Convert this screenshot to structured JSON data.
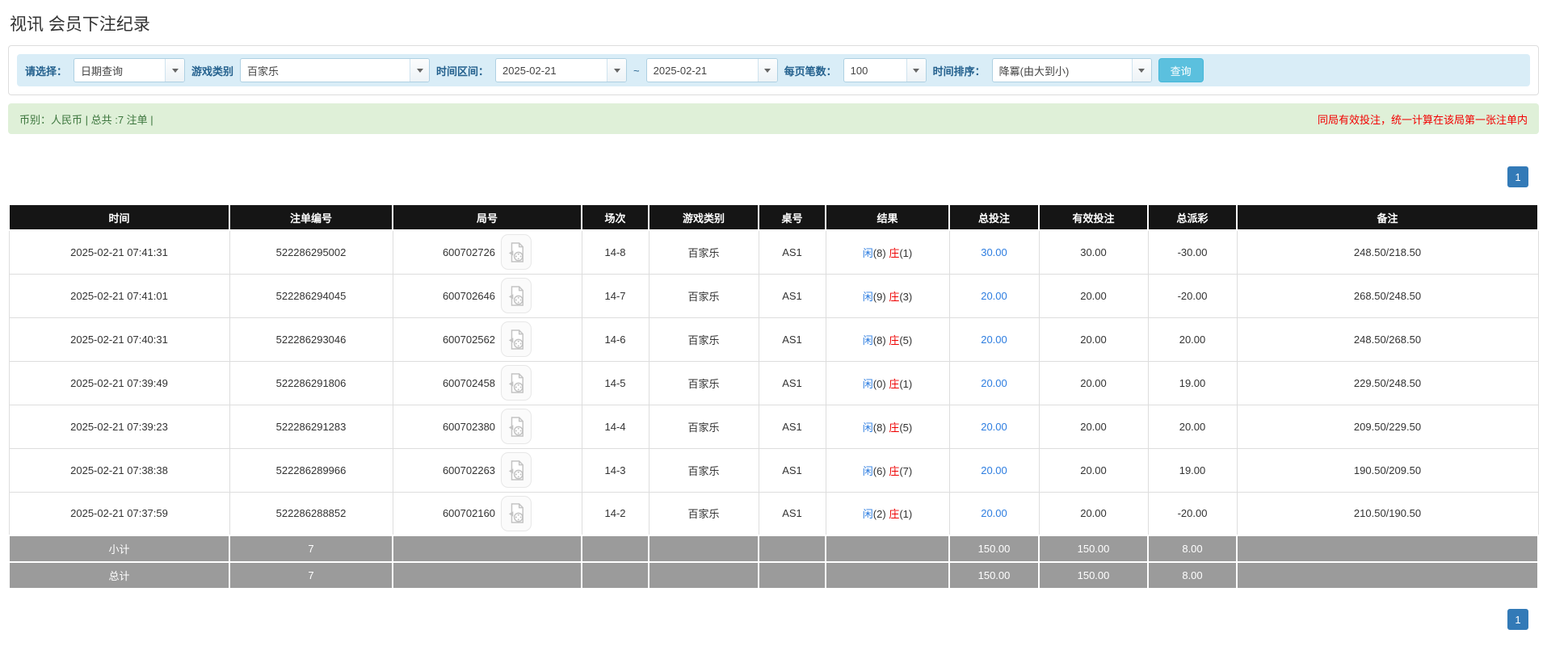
{
  "page": {
    "title": "视讯 会员下注纪录"
  },
  "filters": {
    "select_label": "请选择：",
    "select_value": "日期查询",
    "game_label": "游戏类别",
    "game_value": "百家乐",
    "time_label": "时间区间：",
    "date_from": "2025-02-21",
    "tilde": "~",
    "date_to": "2025-02-21",
    "per_page_label": "每页笔数：",
    "per_page_value": "100",
    "sort_label": "时间排序：",
    "sort_value": "降冪(由大到小)",
    "search_button": "查询"
  },
  "summary_bar": {
    "left": "币别：人民币 | 总共 :7 注单 |",
    "right": "同局有效投注，统一计算在该局第一张注单内"
  },
  "pagination": {
    "page": "1"
  },
  "table": {
    "headers": [
      "时间",
      "注单编号",
      "局号",
      "场次",
      "游戏类别",
      "桌号",
      "结果",
      "总投注",
      "有效投注",
      "总派彩",
      "备注"
    ],
    "rows": [
      {
        "time": "2025-02-21 07:41:31",
        "bet_no": "522286295002",
        "round_no": "600702726",
        "session": "14-8",
        "game": "百家乐",
        "table_no": "AS1",
        "result_player": "闲",
        "result_player_num": "(8)",
        "result_banker": "庄",
        "result_banker_num": "(1)",
        "total_bet": "30.00",
        "valid_bet": "30.00",
        "payout": "-30.00",
        "note": "248.50/218.50"
      },
      {
        "time": "2025-02-21 07:41:01",
        "bet_no": "522286294045",
        "round_no": "600702646",
        "session": "14-7",
        "game": "百家乐",
        "table_no": "AS1",
        "result_player": "闲",
        "result_player_num": "(9)",
        "result_banker": "庄",
        "result_banker_num": "(3)",
        "total_bet": "20.00",
        "valid_bet": "20.00",
        "payout": "-20.00",
        "note": "268.50/248.50"
      },
      {
        "time": "2025-02-21 07:40:31",
        "bet_no": "522286293046",
        "round_no": "600702562",
        "session": "14-6",
        "game": "百家乐",
        "table_no": "AS1",
        "result_player": "闲",
        "result_player_num": "(8)",
        "result_banker": "庄",
        "result_banker_num": "(5)",
        "total_bet": "20.00",
        "valid_bet": "20.00",
        "payout": "20.00",
        "note": "248.50/268.50"
      },
      {
        "time": "2025-02-21 07:39:49",
        "bet_no": "522286291806",
        "round_no": "600702458",
        "session": "14-5",
        "game": "百家乐",
        "table_no": "AS1",
        "result_player": "闲",
        "result_player_num": "(0)",
        "result_banker": "庄",
        "result_banker_num": "(1)",
        "total_bet": "20.00",
        "valid_bet": "20.00",
        "payout": "19.00",
        "note": "229.50/248.50"
      },
      {
        "time": "2025-02-21 07:39:23",
        "bet_no": "522286291283",
        "round_no": "600702380",
        "session": "14-4",
        "game": "百家乐",
        "table_no": "AS1",
        "result_player": "闲",
        "result_player_num": "(8)",
        "result_banker": "庄",
        "result_banker_num": "(5)",
        "total_bet": "20.00",
        "valid_bet": "20.00",
        "payout": "20.00",
        "note": "209.50/229.50"
      },
      {
        "time": "2025-02-21 07:38:38",
        "bet_no": "522286289966",
        "round_no": "600702263",
        "session": "14-3",
        "game": "百家乐",
        "table_no": "AS1",
        "result_player": "闲",
        "result_player_num": "(6)",
        "result_banker": "庄",
        "result_banker_num": "(7)",
        "total_bet": "20.00",
        "valid_bet": "20.00",
        "payout": "19.00",
        "note": "190.50/209.50"
      },
      {
        "time": "2025-02-21 07:37:59",
        "bet_no": "522286288852",
        "round_no": "600702160",
        "session": "14-2",
        "game": "百家乐",
        "table_no": "AS1",
        "result_player": "闲",
        "result_player_num": "(2)",
        "result_banker": "庄",
        "result_banker_num": "(1)",
        "total_bet": "20.00",
        "valid_bet": "20.00",
        "payout": "-20.00",
        "note": "210.50/190.50"
      }
    ],
    "subtotal": {
      "label": "小计",
      "count": "7",
      "total_bet": "150.00",
      "valid_bet": "150.00",
      "payout": "8.00"
    },
    "total": {
      "label": "总计",
      "count": "7",
      "total_bet": "150.00",
      "valid_bet": "150.00",
      "payout": "8.00"
    }
  },
  "colors": {
    "accent_blue": "#2d7de0",
    "negative_red": "#ee0000",
    "header_bg": "#151515",
    "summary_row_bg": "#9b9b9b",
    "filter_bar_bg": "#d9edf7",
    "info_bar_bg": "#dff0d8",
    "search_button_bg": "#5bc0de",
    "pager_bg": "#337ab7"
  }
}
